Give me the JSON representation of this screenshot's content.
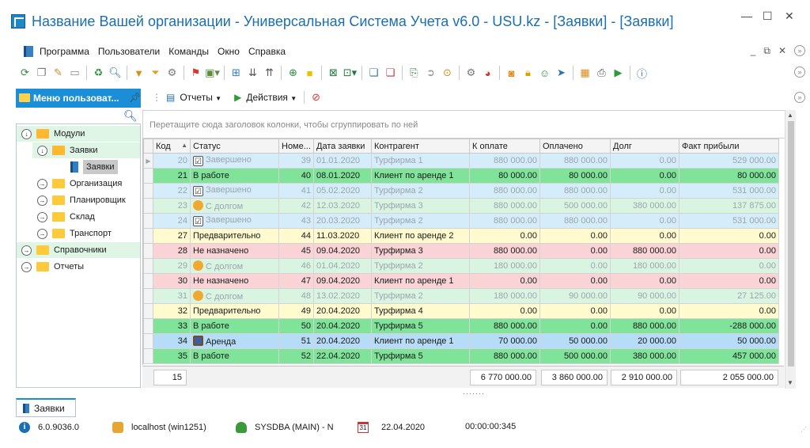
{
  "window": {
    "title": "Название Вашей организации - Универсальная Система Учета v6.0 - USU.kz - [Заявки] - [Заявки]",
    "controls": [
      "—",
      "☐",
      "✕"
    ]
  },
  "menubar": {
    "items": [
      "Программа",
      "Пользователи",
      "Команды",
      "Окно",
      "Справка"
    ],
    "mdi_controls": [
      "_",
      "⧉",
      "✕"
    ]
  },
  "toolbar": {
    "icons": [
      "refresh-icon",
      "copy-icon",
      "edit-icon",
      "delete-icon",
      "sync-icon",
      "search-icon",
      "filter-icon",
      "filter-clear-icon",
      "filter-settings-icon",
      "flag-icon",
      "image-icon",
      "columns-icon",
      "collapse-icon",
      "expand-icon",
      "add-row-icon",
      "note-icon",
      "excel-icon",
      "export-icon",
      "new-window-icon",
      "close-window-icon",
      "exit-icon",
      "arrow-icon",
      "pin-icon",
      "settings-icon",
      "color-icon",
      "rss-icon",
      "lock-icon",
      "users-icon",
      "pointer-icon",
      "table-icon",
      "print-icon",
      "play-icon",
      "info-icon"
    ]
  },
  "sidebar": {
    "title": "Меню пользоват...",
    "tree": [
      {
        "label": "Модули",
        "level": 0,
        "expander": "↓",
        "type": "folder-open",
        "band": true
      },
      {
        "label": "Заявки",
        "level": 1,
        "expander": "↓",
        "type": "folder-open",
        "band": true
      },
      {
        "label": "Заявки",
        "level": 2,
        "expander": "",
        "type": "doc",
        "band": false,
        "selected": true
      },
      {
        "label": "Организация",
        "level": 1,
        "expander": "→",
        "type": "folder",
        "band": false
      },
      {
        "label": "Планировщик",
        "level": 1,
        "expander": "→",
        "type": "folder",
        "band": false
      },
      {
        "label": "Склад",
        "level": 1,
        "expander": "→",
        "type": "folder",
        "band": false
      },
      {
        "label": "Транспорт",
        "level": 1,
        "expander": "→",
        "type": "folder",
        "band": false
      },
      {
        "label": "Справочники",
        "level": 0,
        "expander": "→",
        "type": "folder",
        "band": true
      },
      {
        "label": "Отчеты",
        "level": 0,
        "expander": "→",
        "type": "folder",
        "band": false
      }
    ]
  },
  "subtoolbar": {
    "reports_label": "Отчеты",
    "actions_label": "Действия"
  },
  "grid": {
    "group_hint": "Перетащите сюда заголовок колонки, чтобы сгруппировать по ней",
    "columns": [
      "Код",
      "Статус",
      "Номе...",
      "Дата заявки",
      "Контрагент",
      "К оплате",
      "Оплачено",
      "Долг",
      "Факт прибыли"
    ],
    "rows": [
      {
        "code": "20",
        "status": "Завершено",
        "icon": "check",
        "num": "39",
        "date": "01.01.2020",
        "client": "Турфирма 1",
        "to_pay": "880 000.00",
        "paid": "880 000.00",
        "debt": "0.00",
        "profit": "529 000.00",
        "bg": "#d5ecfa",
        "dim": true,
        "current": true
      },
      {
        "code": "21",
        "status": "В работе",
        "icon": "",
        "num": "40",
        "date": "08.01.2020",
        "client": "Клиент по аренде 1",
        "to_pay": "80 000.00",
        "paid": "80 000.00",
        "debt": "0.00",
        "profit": "80 000.00",
        "bg": "#7fe39a",
        "dim": false
      },
      {
        "code": "22",
        "status": "Завершено",
        "icon": "check",
        "num": "41",
        "date": "05.02.2020",
        "client": "Турфирма 2",
        "to_pay": "880 000.00",
        "paid": "880 000.00",
        "debt": "0.00",
        "profit": "531 000.00",
        "bg": "#d5ecfa",
        "dim": true
      },
      {
        "code": "23",
        "status": "С долгом",
        "icon": "coins",
        "num": "42",
        "date": "12.03.2020",
        "client": "Турфирма 3",
        "to_pay": "880 000.00",
        "paid": "500 000.00",
        "debt": "380 000.00",
        "profit": "137 875.00",
        "bg": "#d9f5e2",
        "dim": true
      },
      {
        "code": "24",
        "status": "Завершено",
        "icon": "check",
        "num": "43",
        "date": "20.03.2020",
        "client": "Турфирма 2",
        "to_pay": "880 000.00",
        "paid": "880 000.00",
        "debt": "0.00",
        "profit": "531 000.00",
        "bg": "#d5ecfa",
        "dim": true
      },
      {
        "code": "27",
        "status": "Предварительно",
        "icon": "",
        "num": "44",
        "date": "11.03.2020",
        "client": "Клиент по аренде 2",
        "to_pay": "0.00",
        "paid": "0.00",
        "debt": "0.00",
        "profit": "0.00",
        "bg": "#fffbcf",
        "dim": false
      },
      {
        "code": "28",
        "status": "Не назначено",
        "icon": "",
        "num": "45",
        "date": "09.04.2020",
        "client": "Турфирма 3",
        "to_pay": "880 000.00",
        "paid": "0.00",
        "debt": "880 000.00",
        "profit": "0.00",
        "bg": "#f9d3d6",
        "dim": false
      },
      {
        "code": "29",
        "status": "С долгом",
        "icon": "coins",
        "num": "46",
        "date": "01.04.2020",
        "client": "Турфирма 2",
        "to_pay": "180 000.00",
        "paid": "0.00",
        "debt": "180 000.00",
        "profit": "0.00",
        "bg": "#d9f5e2",
        "dim": true
      },
      {
        "code": "30",
        "status": "Не назначено",
        "icon": "",
        "num": "47",
        "date": "09.04.2020",
        "client": "Клиент по аренде 1",
        "to_pay": "0.00",
        "paid": "0.00",
        "debt": "0.00",
        "profit": "0.00",
        "bg": "#f9d3d6",
        "dim": false
      },
      {
        "code": "31",
        "status": "С долгом",
        "icon": "coins",
        "num": "48",
        "date": "13.02.2020",
        "client": "Турфирма 2",
        "to_pay": "180 000.00",
        "paid": "90 000.00",
        "debt": "90 000.00",
        "profit": "27 125.00",
        "bg": "#d9f5e2",
        "dim": true
      },
      {
        "code": "32",
        "status": "Предварительно",
        "icon": "",
        "num": "49",
        "date": "20.04.2020",
        "client": "Турфирма 4",
        "to_pay": "0.00",
        "paid": "0.00",
        "debt": "0.00",
        "profit": "0.00",
        "bg": "#fffbcf",
        "dim": false
      },
      {
        "code": "33",
        "status": "В работе",
        "icon": "",
        "num": "50",
        "date": "20.04.2020",
        "client": "Турфирма 5",
        "to_pay": "880 000.00",
        "paid": "0.00",
        "debt": "880 000.00",
        "profit": "-288 000.00",
        "bg": "#7fe39a",
        "dim": false
      },
      {
        "code": "34",
        "status": "Аренда",
        "icon": "monitor",
        "num": "51",
        "date": "20.04.2020",
        "client": "Клиент по аренде 1",
        "to_pay": "70 000.00",
        "paid": "50 000.00",
        "debt": "20 000.00",
        "profit": "50 000.00",
        "bg": "#b6dcf7",
        "dim": false
      },
      {
        "code": "35",
        "status": "В работе",
        "icon": "",
        "num": "52",
        "date": "22.04.2020",
        "client": "Турфирма 5",
        "to_pay": "880 000.00",
        "paid": "500 000.00",
        "debt": "380 000.00",
        "profit": "457 000.00",
        "bg": "#7fe39a",
        "dim": false
      }
    ],
    "footer": {
      "count": "15",
      "to_pay": "6 770 000.00",
      "paid": "3 860 000.00",
      "debt": "2 910 000.00",
      "profit": "2 055 000.00"
    }
  },
  "document_tab": {
    "label": "Заявки"
  },
  "statusbar": {
    "version": "6.0.9036.0",
    "server": "localhost (win1251)",
    "user": "SYSDBA (MAIN) - N",
    "calendar_day": "31",
    "date": "22.04.2020",
    "timer": "00:00:00:345"
  },
  "colors": {
    "accent": "#1a8fd8",
    "title": "#1a6fb3",
    "in_work": "#7fe39a",
    "done": "#d5ecfa",
    "debt": "#d9f5e2",
    "prelim": "#fffbcf",
    "unassigned": "#f9d3d6",
    "rent": "#b6dcf7"
  }
}
